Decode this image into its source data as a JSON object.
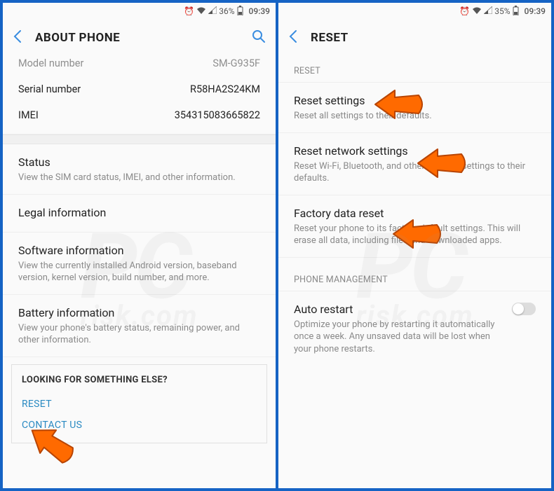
{
  "left": {
    "status": {
      "battery": "36%",
      "time": "09:39"
    },
    "title": "ABOUT PHONE",
    "kv": [
      {
        "label": "Model number",
        "value": "SM-G935F"
      },
      {
        "label": "Serial number",
        "value": "R58HA2S24KM"
      },
      {
        "label": "IMEI",
        "value": "354315083665822"
      }
    ],
    "items": [
      {
        "title": "Status",
        "desc": "View the SIM card status, IMEI, and other information."
      },
      {
        "title": "Legal information",
        "desc": ""
      },
      {
        "title": "Software information",
        "desc": "View the currently installed Android version, baseband version, kernel version, build number, and more."
      },
      {
        "title": "Battery information",
        "desc": "View your phone's battery status, remaining power, and other information."
      }
    ],
    "footer": {
      "title": "LOOKING FOR SOMETHING ELSE?",
      "links": [
        "RESET",
        "CONTACT US"
      ]
    }
  },
  "right": {
    "status": {
      "battery": "35%",
      "time": "09:39"
    },
    "title": "RESET",
    "sections": [
      {
        "label": "RESET",
        "items": [
          {
            "title": "Reset settings",
            "desc": "Reset all settings to their defaults."
          },
          {
            "title": "Reset network settings",
            "desc": "Reset Wi-Fi, Bluetooth, and other network settings to their defaults."
          },
          {
            "title": "Factory data reset",
            "desc": "Reset your phone to its factory default settings. This will erase all data, including files and downloaded apps."
          }
        ]
      },
      {
        "label": "PHONE MANAGEMENT",
        "items": [
          {
            "title": "Auto restart",
            "desc": "Optimize your phone by restarting it automatically once a week. Any unsaved data will be lost when your phone restarts.",
            "toggle": true
          }
        ]
      }
    ]
  },
  "watermark": {
    "big": "PC",
    "small": "risk.com"
  }
}
